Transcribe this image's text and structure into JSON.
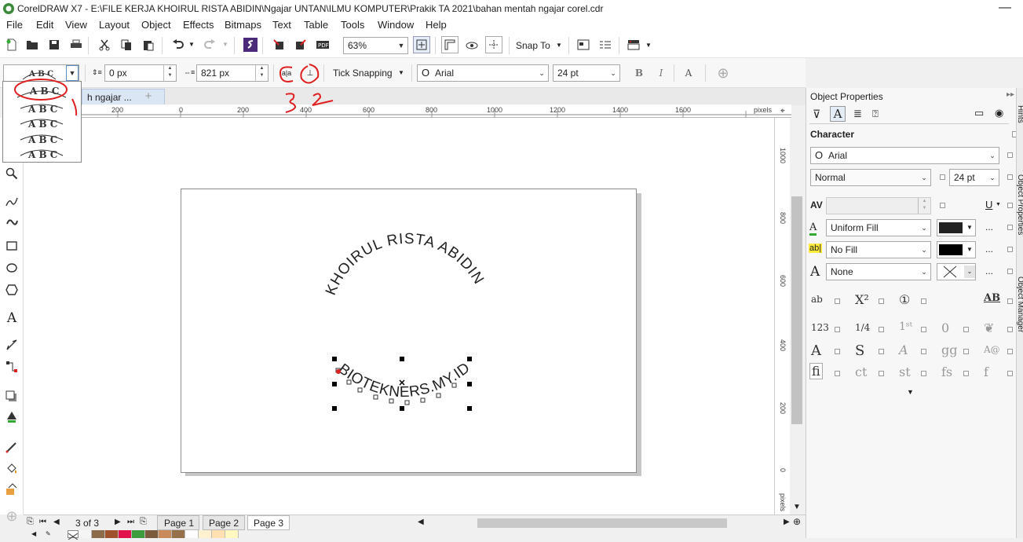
{
  "window": {
    "title": "CorelDRAW X7 - E:\\FILE KERJA KHOIRUL RISTA ABIDIN\\Ngajar UNTAN\\ILMU KOMPUTER\\Prakik TA 2021\\bahan mentah ngajar corel.cdr",
    "minimize": "—"
  },
  "menu": [
    "File",
    "Edit",
    "View",
    "Layout",
    "Object",
    "Effects",
    "Bitmaps",
    "Text",
    "Table",
    "Tools",
    "Window",
    "Help"
  ],
  "toolbar": {
    "zoom": "63%",
    "snap_to": "Snap To"
  },
  "property_bar": {
    "preset_sample": "ABC",
    "distance_from_path": "0 px",
    "offset": "821 px",
    "tick_snapping": "Tick Snapping",
    "font": "Arial",
    "font_size": "24 pt"
  },
  "document": {
    "tab_label": "h ngajar ...",
    "canvas_text_top": "KHOIRUL RISTA ABIDIN",
    "canvas_text_bottom": "BIOTEKNERS.MY.ID"
  },
  "ruler_h": [
    "200",
    "0",
    "200",
    "400",
    "600",
    "800",
    "1000",
    "1200",
    "1400",
    "1600",
    "pixels"
  ],
  "ruler_v": [
    "1000",
    "800",
    "600",
    "400",
    "200",
    "0",
    "pixels"
  ],
  "pages": {
    "counter": "3 of 3",
    "tabs": [
      "Page 1",
      "Page 2",
      "Page 3"
    ]
  },
  "palette_colors": [
    "#f5f5f5",
    "#8b6b4a",
    "#a0522d",
    "#e0114b",
    "#3c9b3c",
    "#7a5c3c",
    "#c88a5a",
    "#96704a",
    "#fdfdfd",
    "#fff0d0",
    "#ffe0b0",
    "#fff8c0"
  ],
  "object_properties": {
    "title": "Object Properties",
    "section": "Character",
    "font": "Arial",
    "style": "Normal",
    "size": "24 pt",
    "text_fill": "Uniform Fill",
    "fill_color": "#222222",
    "background_fill": "No Fill",
    "bg_color": "#000000",
    "outline": "None",
    "more": "...",
    "side_tabs": [
      "Hints",
      "Object Properties",
      "Object Manager"
    ]
  },
  "annotations": {
    "mark_1": "1",
    "mark_2": "2",
    "mark_3": "3"
  }
}
